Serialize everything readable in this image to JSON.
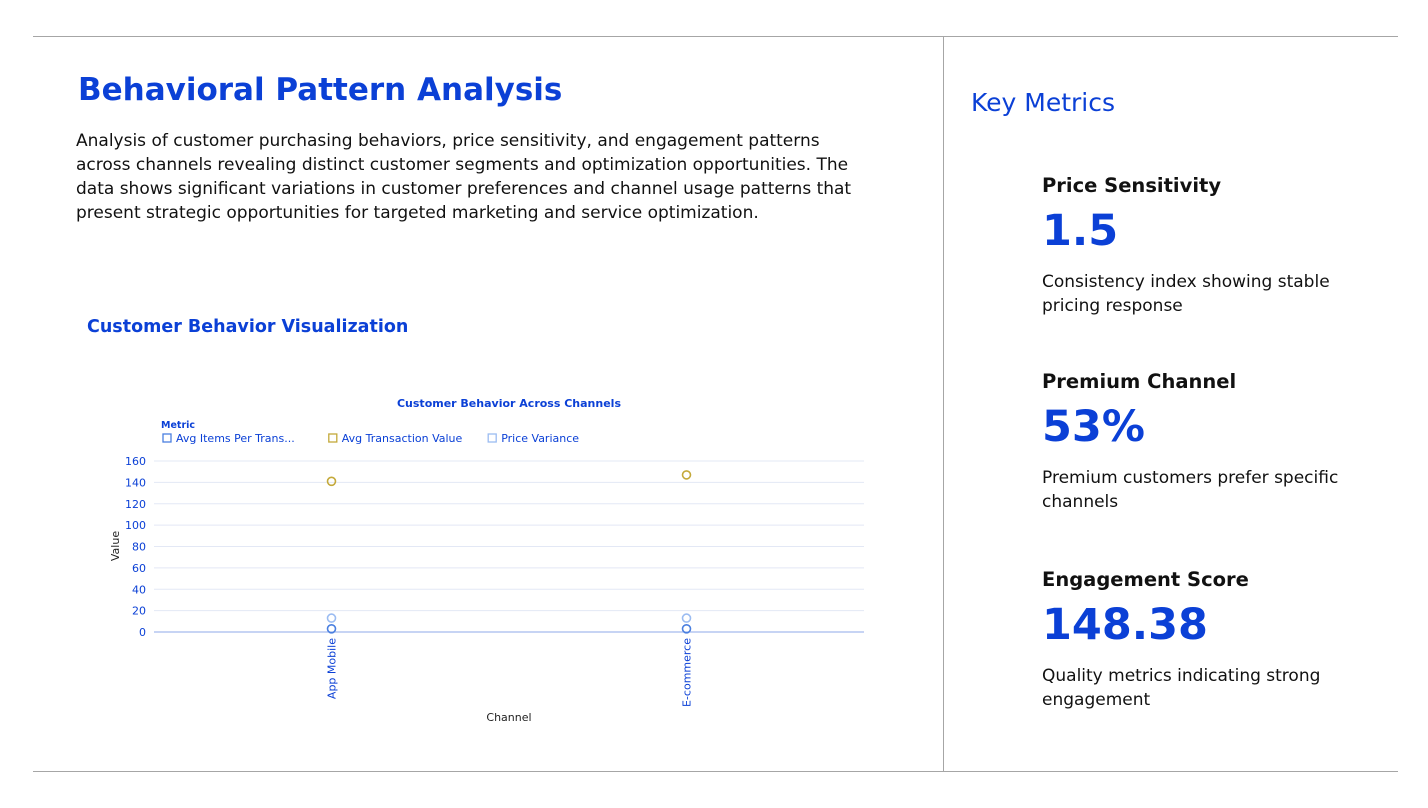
{
  "page": {
    "title": "Behavioral Pattern Analysis",
    "intro": "Analysis of customer purchasing behaviors, price sensitivity, and engagement patterns across channels revealing distinct customer segments and optimization opportunities. The data shows significant variations in customer preferences and channel usage patterns that present strategic opportunities for targeted marketing and service optimization.",
    "viz_title": "Customer Behavior Visualization"
  },
  "metrics": {
    "title": "Key Metrics",
    "items": [
      {
        "label": "Price Sensitivity",
        "value": "1.5",
        "desc": "Consistency index showing stable pricing response"
      },
      {
        "label": "Premium Channel",
        "value": "53%",
        "desc": "Premium customers prefer specific channels"
      },
      {
        "label": "Engagement Score",
        "value": "148.38",
        "desc": "Quality metrics indicating strong engagement"
      }
    ]
  },
  "chart_data": {
    "type": "scatter",
    "title": "Customer Behavior Across Channels",
    "xlabel": "Channel",
    "ylabel": "Value",
    "legend_title": "Metric",
    "legend_position": "top-left",
    "categories": [
      "App Mobile",
      "E-commerce"
    ],
    "ylim": [
      0,
      160
    ],
    "yticks": [
      0,
      20,
      40,
      60,
      80,
      100,
      120,
      140,
      160
    ],
    "grid": true,
    "series": [
      {
        "name": "Avg Items Per Trans...",
        "color": "#4a7fe0",
        "values": [
          3,
          3
        ]
      },
      {
        "name": "Avg Transaction Value",
        "color": "#c4a93a",
        "values": [
          141,
          147
        ]
      },
      {
        "name": "Price Variance",
        "color": "#9bbcf2",
        "values": [
          13,
          13
        ]
      }
    ]
  }
}
